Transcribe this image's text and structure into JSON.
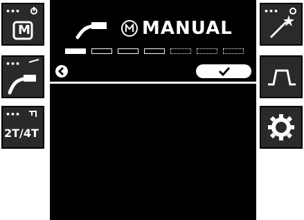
{
  "screen": {
    "mode_icon": "manual-mode-icon",
    "title": "MANUAL",
    "progress": {
      "total_steps": 7,
      "current_step": 1
    },
    "back_icon": "back-chevron-icon",
    "confirm_icon": "checkmark-icon"
  },
  "left_buttons": [
    {
      "icon": "power-mode-icon",
      "label": "M"
    },
    {
      "icon": "torch-icon",
      "label": ""
    },
    {
      "icon": "trigger-icon",
      "label": "2T/4T"
    }
  ],
  "right_buttons": [
    {
      "icon": "wire-spark-wand-icon",
      "label": ""
    },
    {
      "icon": "pulse-waveform-icon",
      "label": ""
    },
    {
      "icon": "gear-icon",
      "label": ""
    }
  ],
  "colors": {
    "screen_bg": "#000000",
    "button_bg": "#2a2a2a",
    "foreground": "#ffffff"
  }
}
